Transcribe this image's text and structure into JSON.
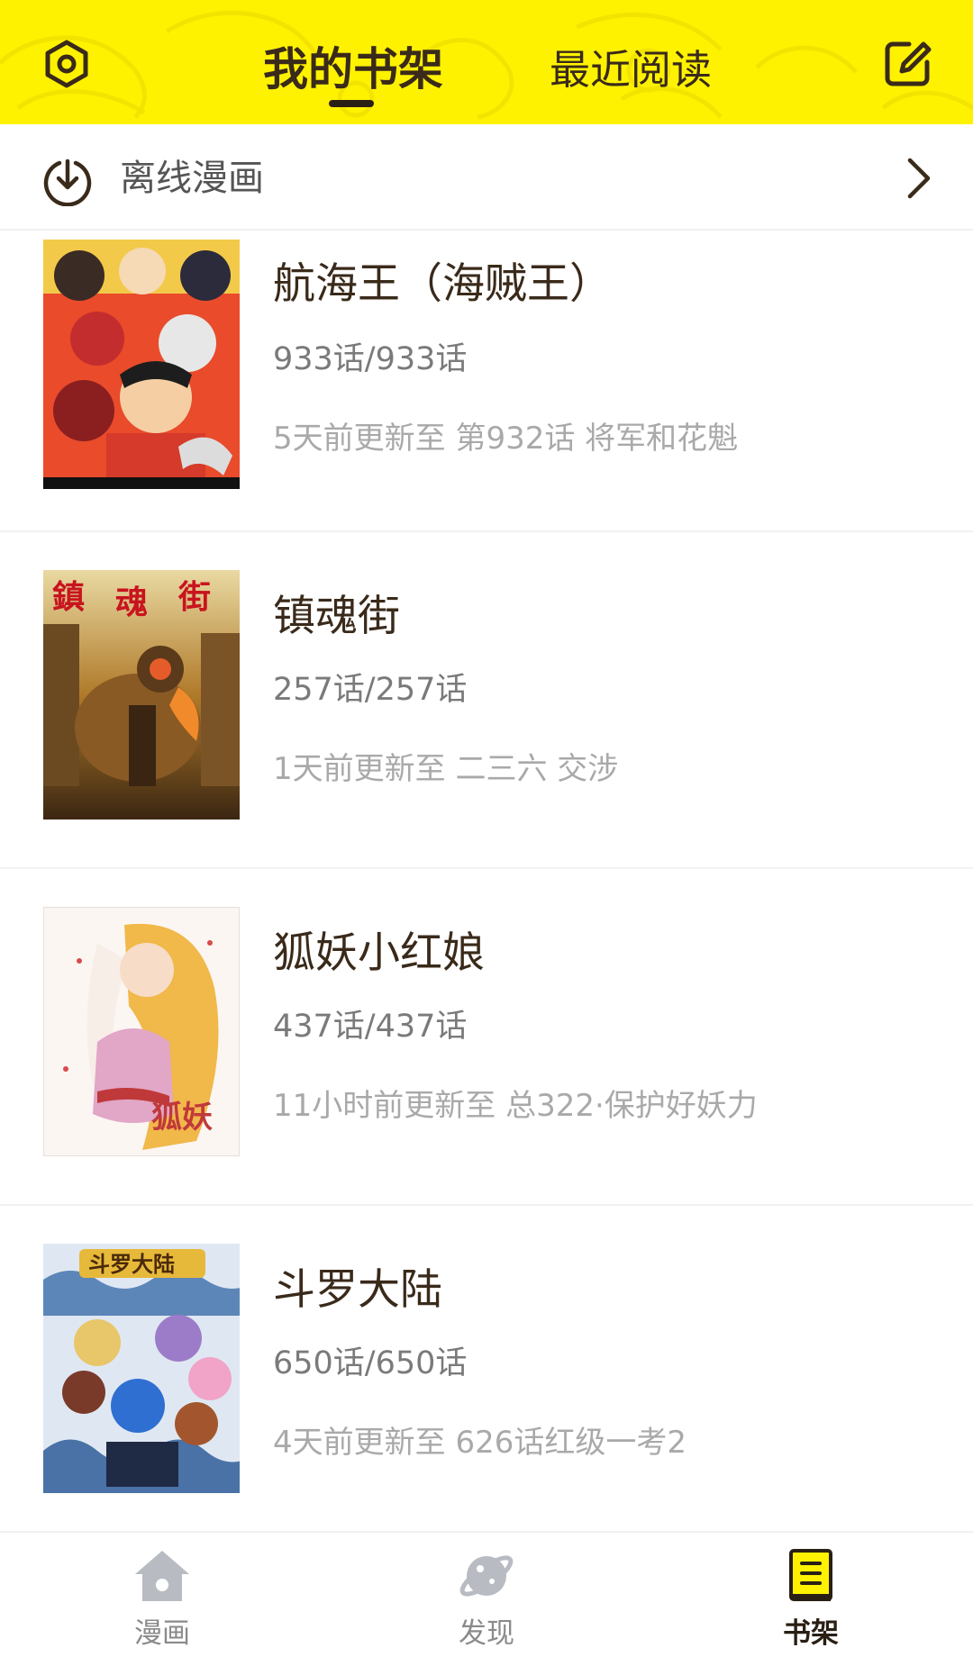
{
  "header": {
    "tabs": [
      {
        "label": "我的书架",
        "active": true
      },
      {
        "label": "最近阅读",
        "active": false
      }
    ],
    "background_color": "#FFF200",
    "left_icon": "settings-icon",
    "right_icon": "edit-icon"
  },
  "offline": {
    "label": "离线漫画",
    "icon": "download-icon",
    "trailing_icon": "chevron-right-icon"
  },
  "comics": [
    {
      "title": "航海王（海贼王）",
      "progress": "933话/933话",
      "update": "5天前更新至 第932话 将军和花魁"
    },
    {
      "title": "镇魂街",
      "progress": "257话/257话",
      "update": "1天前更新至 二三六 交涉"
    },
    {
      "title": "狐妖小红娘",
      "progress": "437话/437话",
      "update": "11小时前更新至 总322·保护好妖力"
    },
    {
      "title": "斗罗大陆",
      "progress": "650话/650话",
      "update": "4天前更新至 626话红级一考2"
    }
  ],
  "bottom_nav": [
    {
      "label": "漫画",
      "icon": "home-icon",
      "active": false
    },
    {
      "label": "发现",
      "icon": "planet-icon",
      "active": false
    },
    {
      "label": "书架",
      "icon": "book-icon",
      "active": true
    }
  ]
}
